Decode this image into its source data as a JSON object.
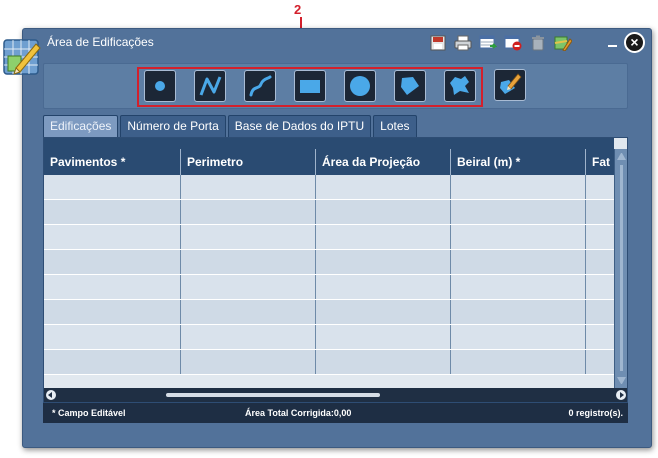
{
  "callout": {
    "number": "2"
  },
  "window": {
    "title": "Área de Edificações"
  },
  "tabs": [
    {
      "label": "Edificações",
      "active": true
    },
    {
      "label": "Número de Porta",
      "active": false
    },
    {
      "label": "Base de Dados do IPTU",
      "active": false
    },
    {
      "label": "Lotes",
      "active": false
    }
  ],
  "grid": {
    "columns": [
      "Pavimentos *",
      "Perimetro",
      "Área da Projeção",
      "Beiral (m) *",
      "Fat"
    ],
    "rows_visible": 8
  },
  "status": {
    "editable_note": "* Campo Editável",
    "total": "Área Total Corrigida:0,00",
    "count": "0 registro(s)."
  },
  "toolbar": {
    "drawing_tools": [
      "point-tool",
      "line-tool",
      "curve-tool",
      "rectangle-tool",
      "circle-tool",
      "polygon-tool",
      "freeform-tool"
    ],
    "edit_tool": "edit-polygon-tool"
  },
  "colors": {
    "callout": "#d3202c",
    "window": "#52729a",
    "header": "#2a4b72"
  }
}
